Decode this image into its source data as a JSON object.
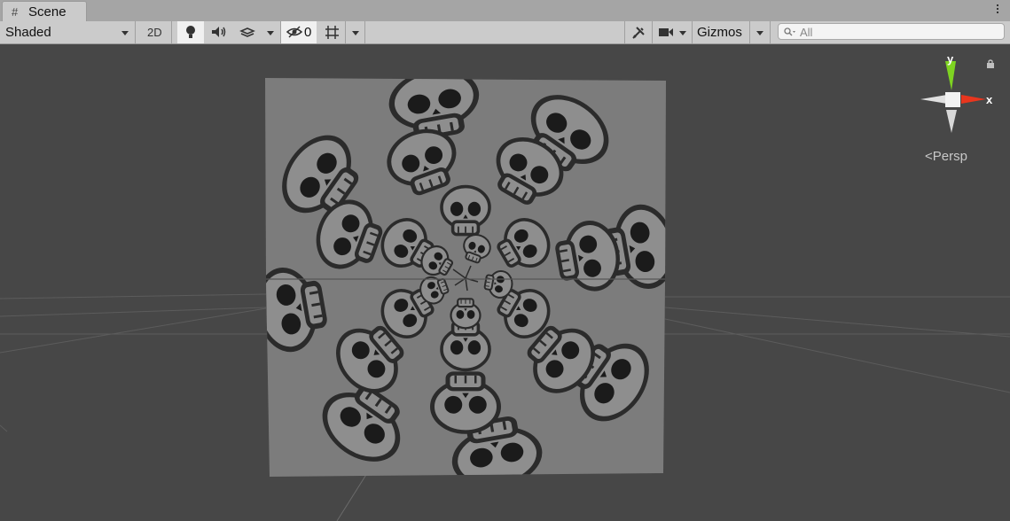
{
  "tab": {
    "title": "Scene"
  },
  "toolbar": {
    "shading_mode": "Shaded",
    "mode_2d": "2D",
    "hidden_count": "0",
    "gizmos_label": "Gizmos",
    "search_placeholder": "All"
  },
  "viewport": {
    "projection_label": "Persp",
    "axis_x": "x",
    "axis_y": "y",
    "object": "skull-pattern-textured-quad"
  },
  "colors": {
    "toolbar_bg": "#cbcbcb",
    "viewport_bg": "#474747",
    "axis_x": "#e8361e",
    "axis_y": "#7ed321"
  }
}
